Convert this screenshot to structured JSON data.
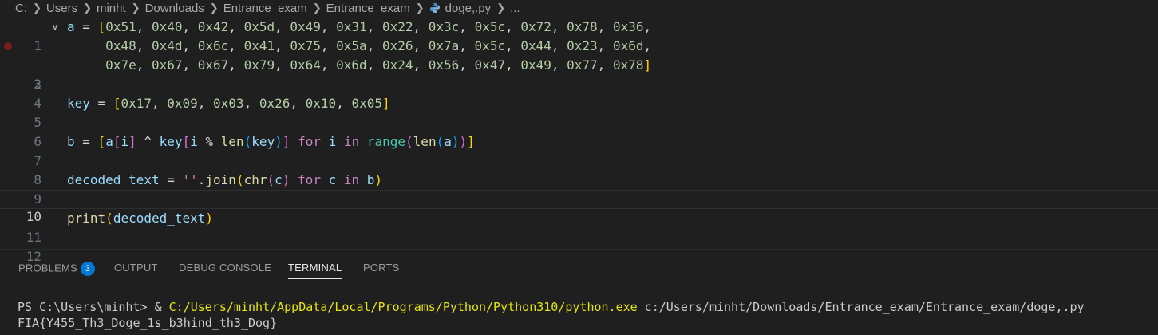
{
  "breadcrumb": {
    "items": [
      "C:",
      "Users",
      "minht",
      "Downloads",
      "Entrance_exam",
      "Entrance_exam"
    ],
    "file": "doge,.py",
    "trailing": "..."
  },
  "editor": {
    "current_line": 10,
    "lines": [
      {
        "num": "1"
      },
      {
        "num": "2"
      },
      {
        "num": "3"
      },
      {
        "num": "4"
      },
      {
        "num": "5"
      },
      {
        "num": "6"
      },
      {
        "num": "7"
      },
      {
        "num": "8"
      },
      {
        "num": "9"
      },
      {
        "num": "10"
      },
      {
        "num": "11"
      },
      {
        "num": "12"
      }
    ],
    "a_values_row1": [
      "0x51",
      "0x40",
      "0x42",
      "0x5d",
      "0x49",
      "0x31",
      "0x22",
      "0x3c",
      "0x5c",
      "0x72",
      "0x78",
      "0x36"
    ],
    "a_values_row2": [
      "0x48",
      "0x4d",
      "0x6c",
      "0x41",
      "0x75",
      "0x5a",
      "0x26",
      "0x7a",
      "0x5c",
      "0x44",
      "0x23",
      "0x6d"
    ],
    "a_values_row3": [
      "0x7e",
      "0x67",
      "0x67",
      "0x79",
      "0x64",
      "0x6d",
      "0x24",
      "0x56",
      "0x47",
      "0x49",
      "0x77",
      "0x78"
    ],
    "key_values": [
      "0x17",
      "0x09",
      "0x03",
      "0x26",
      "0x10",
      "0x05"
    ]
  },
  "panel": {
    "tabs": [
      {
        "label": "PROBLEMS",
        "badge": "3"
      },
      {
        "label": "OUTPUT"
      },
      {
        "label": "DEBUG CONSOLE"
      },
      {
        "label": "TERMINAL"
      },
      {
        "label": "PORTS"
      }
    ],
    "active_tab": "TERMINAL"
  },
  "terminal": {
    "prompt": "PS C:\\Users\\minht> ",
    "operator": "& ",
    "exe_path": "C:/Users/minht/AppData/Local/Programs/Python/Python310/python.exe",
    "script_arg": " c:/Users/minht/Downloads/Entrance_exam/Entrance_exam/doge,.py",
    "output": "FIA{Y455_Th3_Doge_1s_b3hind_th3_Dog}"
  },
  "colors": {
    "background": "#1f1f1f",
    "variable": "#9cdcfe",
    "number": "#b5cea8",
    "function": "#dcdcaa",
    "keyword": "#c586c0",
    "bracket_gold": "#ffd700",
    "bracket_orchid": "#da70d6",
    "bracket_blue": "#179fff",
    "badge": "#0078d4",
    "terminal_path": "#e5e510"
  }
}
